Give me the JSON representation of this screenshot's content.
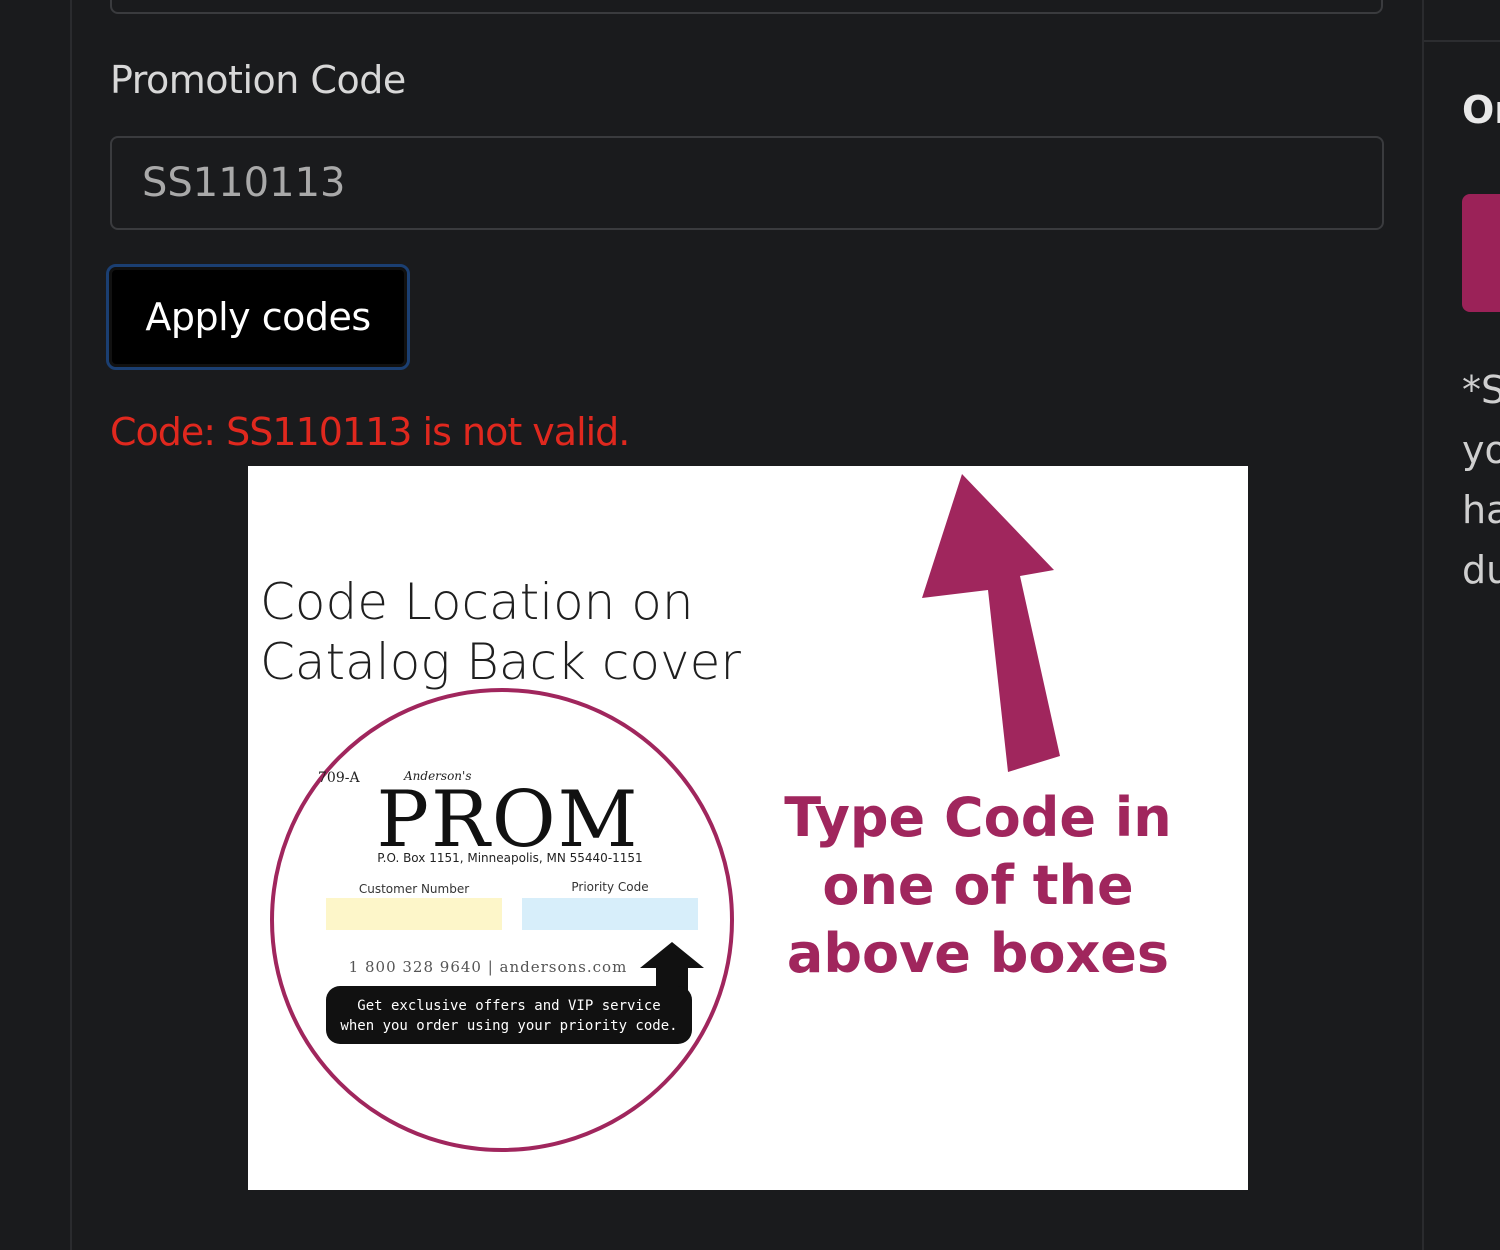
{
  "form": {
    "promo_label": "Promotion Code",
    "promo_value": "SS110113",
    "apply_label": "Apply codes",
    "error_message": "Code: SS110113 is not valid."
  },
  "image": {
    "heading_line1": "Code Location on",
    "heading_line2": "Catalog Back cover",
    "callout_line1": "Type Code in",
    "callout_line2": "one of the",
    "callout_line3": "above boxes",
    "catalog": {
      "corner_code": "709-A",
      "script_brand": "Anderson's",
      "title": "PROM",
      "address": "P.O. Box 1151, Minneapolis, MN 55440-1151",
      "customer_number_label": "Customer Number",
      "priority_code_label": "Priority Code",
      "phone_web": "1 800 328 9640 | andersons.com",
      "offer_line1": "Get exclusive offers and VIP service",
      "offer_line2": "when you order using your priority code."
    },
    "colors": {
      "accent": "#a0265d",
      "customer_box": "#fdf6c9",
      "priority_box": "#d7eefa"
    }
  },
  "right_column": {
    "title_fragment": "Or",
    "text_fragments": [
      "*S",
      "yo",
      "ha",
      "du"
    ]
  }
}
